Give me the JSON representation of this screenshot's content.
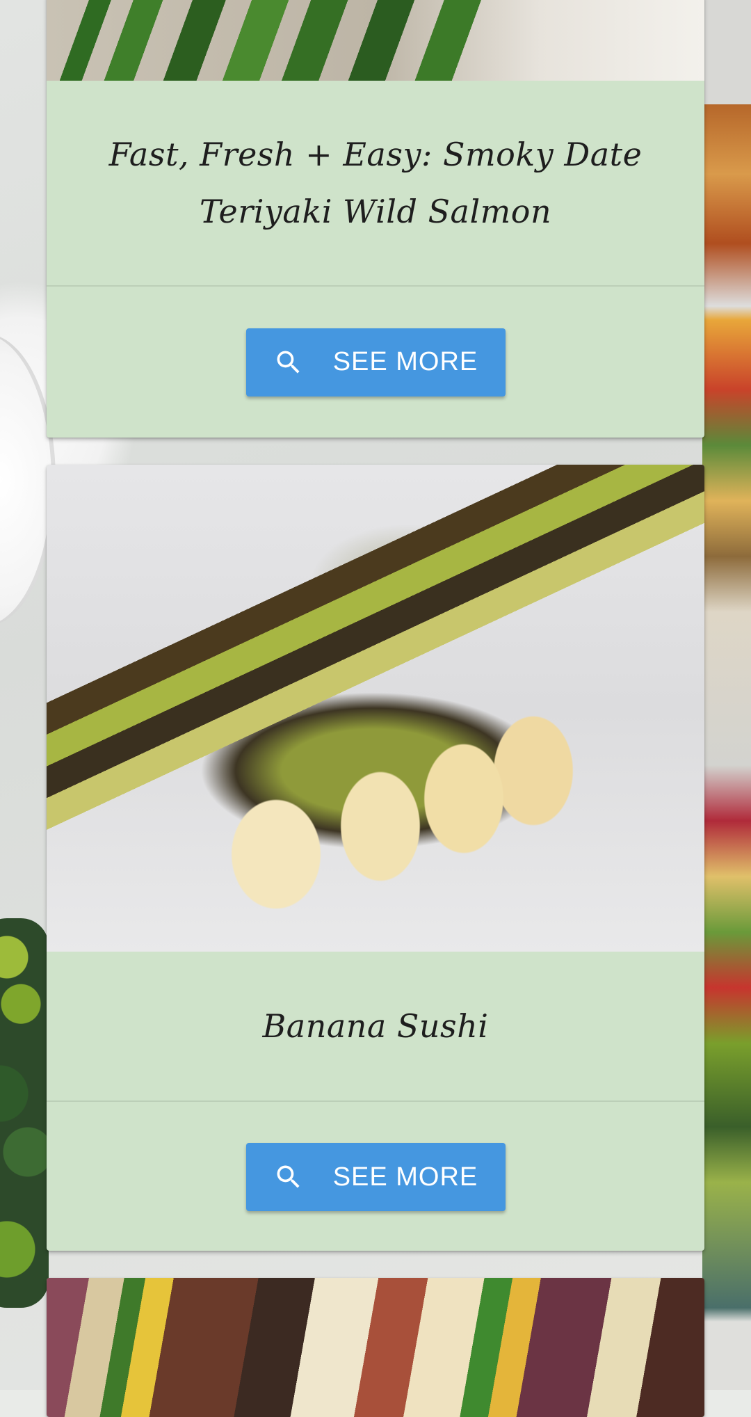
{
  "recipes": [
    {
      "title": "Fast, Fresh + Easy: Smoky Date Teriyaki Wild Salmon",
      "button_label": "SEE MORE",
      "button_icon": "search-icon"
    },
    {
      "title": "Banana Sushi",
      "button_label": "SEE MORE",
      "button_icon": "search-icon"
    }
  ],
  "theme": {
    "card_background": "#cfe3ca",
    "button_color": "#4597e0",
    "button_text_color": "#ffffff"
  }
}
